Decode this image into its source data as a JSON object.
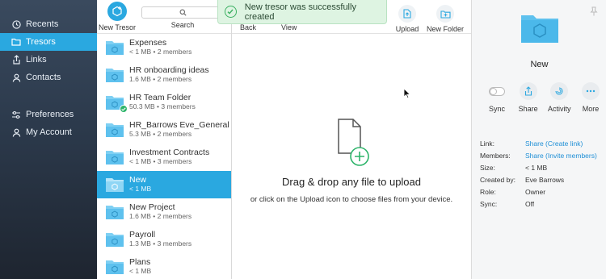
{
  "sidebar": {
    "items": [
      {
        "label": "Recents",
        "icon": "clock-icon",
        "active": false
      },
      {
        "label": "Tresors",
        "icon": "folder-icon",
        "active": true
      },
      {
        "label": "Links",
        "icon": "share-icon",
        "active": false
      },
      {
        "label": "Contacts",
        "icon": "person-icon",
        "active": false
      }
    ],
    "settings": [
      {
        "label": "Preferences",
        "icon": "sliders-icon"
      },
      {
        "label": "My Account",
        "icon": "person-icon"
      }
    ]
  },
  "list_header": {
    "new_tresor_label": "New Tresor",
    "search_label": "Search"
  },
  "tresors": [
    {
      "name": "Expenses",
      "meta": "< 1 MB • 2 members",
      "shared": false,
      "selected": false
    },
    {
      "name": "HR onboarding ideas",
      "meta": "1.6 MB • 2 members",
      "shared": false,
      "selected": false
    },
    {
      "name": "HR Team Folder",
      "meta": "50.3 MB • 3 members",
      "shared": true,
      "selected": false
    },
    {
      "name": "HR_Barrows Eve_General",
      "meta": "5.3 MB • 2 members",
      "shared": false,
      "selected": false
    },
    {
      "name": "Investment Contracts",
      "meta": "< 1 MB • 3 members",
      "shared": false,
      "selected": false
    },
    {
      "name": "New",
      "meta": "< 1 MB",
      "shared": false,
      "selected": true
    },
    {
      "name": "New Project",
      "meta": "1.6 MB • 2 members",
      "shared": false,
      "selected": false
    },
    {
      "name": "Payroll",
      "meta": "1.3 MB • 3 members",
      "shared": false,
      "selected": false
    },
    {
      "name": "Plans",
      "meta": "< 1 MB",
      "shared": false,
      "selected": false
    }
  ],
  "toolbar": {
    "back_label": "Back",
    "view_label": "View",
    "upload_label": "Upload",
    "new_folder_label": "New Folder"
  },
  "toast": {
    "message": "New tresor was successfully created"
  },
  "dropzone": {
    "title": "Drag & drop any file to upload",
    "subtitle": "or click on the Upload icon to choose files from your device."
  },
  "details": {
    "name": "New",
    "actions": [
      {
        "label": "Sync",
        "icon": "toggle-icon"
      },
      {
        "label": "Share",
        "icon": "share-icon"
      },
      {
        "label": "Activity",
        "icon": "activity-icon"
      },
      {
        "label": "More",
        "icon": "more-icon"
      }
    ],
    "properties": [
      {
        "key": "Link:",
        "value": "Share (Create link)",
        "link": true
      },
      {
        "key": "Members:",
        "value": "Share (Invite members)",
        "link": true
      },
      {
        "key": "Size:",
        "value": "< 1 MB",
        "link": false
      },
      {
        "key": "Created by:",
        "value": "Eve Barrows",
        "link": false
      },
      {
        "key": "Role:",
        "value": "Owner",
        "link": false
      },
      {
        "key": "Sync:",
        "value": "Off",
        "link": false
      }
    ]
  },
  "colors": {
    "accent": "#2aa8e0",
    "success": "#2db46a",
    "toast_bg": "#def4e2"
  }
}
